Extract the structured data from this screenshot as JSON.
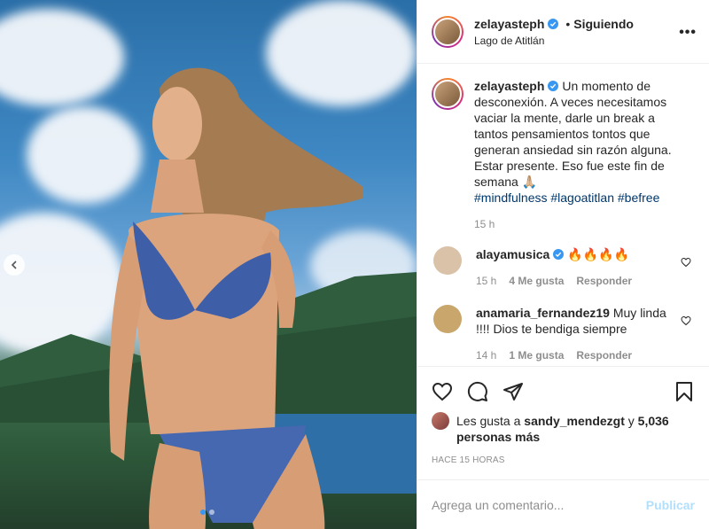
{
  "post": {
    "username": "zelayasteph",
    "separator": "•",
    "follow_label": "Siguiendo",
    "location": "Lago de Atitlán",
    "more_label": "•••"
  },
  "caption": {
    "username": "zelayasteph",
    "text": "Un momento de desconexión. A veces necesitamos vaciar la mente, darle un break a tantos pensamientos tontos que generan ansiedad sin razón alguna. Estar presente. Eso fue este fin de semana 🙏🏼",
    "hashtags": "#mindfulness #lagoatitlan #befree",
    "time": "15 h"
  },
  "comments": [
    {
      "username": "alayamusica",
      "text": "🔥🔥🔥🔥",
      "time": "15 h",
      "likes": "4 Me gusta",
      "reply": "Responder",
      "avatar_color": "#d9c2a8"
    },
    {
      "username": "anamaria_fernandez19",
      "text": "Muy linda !!!! Dios te bendiga siempre",
      "time": "14 h",
      "likes": "1 Me gusta",
      "reply": "Responder",
      "avatar_color": "#c9a66b"
    }
  ],
  "likes": {
    "prefix": "Les gusta a",
    "user": "sandy_mendezgt",
    "conj": "y",
    "others": "5,036 personas más"
  },
  "timestamp": "HACE 15 HORAS",
  "add_comment": {
    "placeholder": "Agrega un comentario...",
    "publish_label": "Publicar"
  },
  "colors": {
    "accent": "#3897f0",
    "link": "#00376b",
    "muted": "#8e8e8e",
    "publish_disabled": "#b2dffc"
  },
  "carousel": {
    "current": 1,
    "total": 2
  }
}
